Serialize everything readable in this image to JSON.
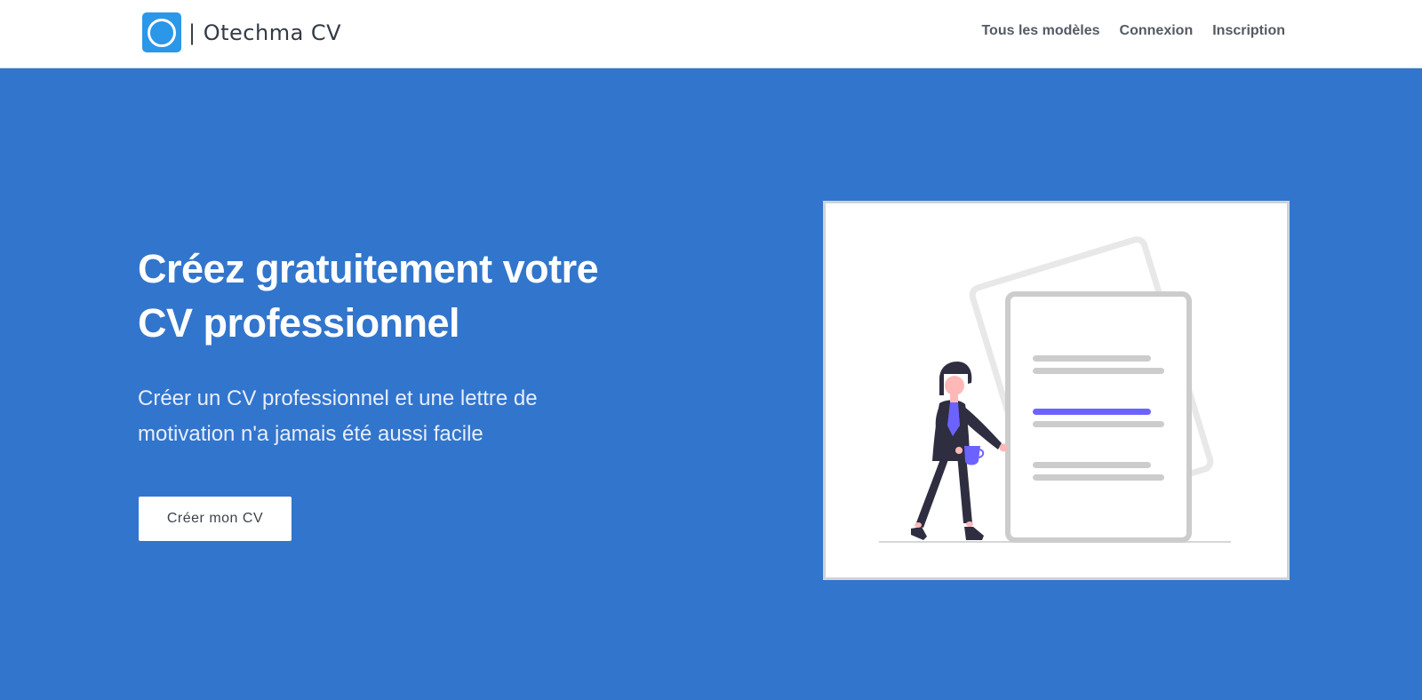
{
  "header": {
    "brand": "| Otechma CV",
    "logo_icon": "circle-logo-icon",
    "nav": [
      {
        "label": "Tous les modèles"
      },
      {
        "label": "Connexion"
      },
      {
        "label": "Inscription"
      }
    ]
  },
  "hero": {
    "title_line1": "Créez gratuitement votre",
    "title_line2": "CV professionnel",
    "subtitle_line1": "Créer un CV professionnel et une lettre de",
    "subtitle_line2": "motivation n'a jamais été aussi facile",
    "cta_label": "Créer mon CV"
  },
  "illustration": {
    "icon": "woman-with-document-illustration"
  },
  "colors": {
    "hero_background": "#3275cc",
    "logo": "#2a97e9",
    "accent_line": "#6c63ff"
  }
}
